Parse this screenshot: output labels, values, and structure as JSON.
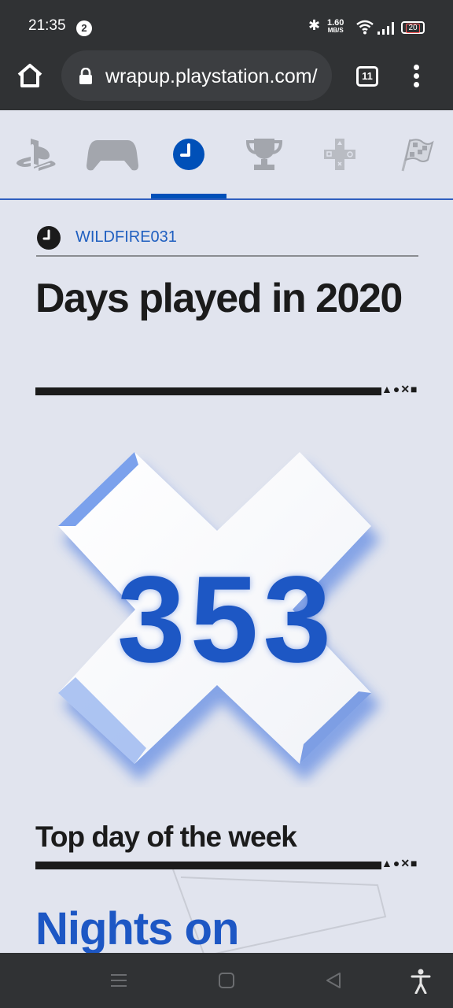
{
  "status_bar": {
    "time": "21:35",
    "notification_count": "2",
    "net_speed_value": "1.60",
    "net_speed_unit": "MB/S",
    "battery": "20"
  },
  "browser": {
    "url": "wrapup.playstation.com/",
    "tab_count": "11"
  },
  "nav": {
    "icons": [
      "playstation-logo-icon",
      "controller-icon",
      "clock-icon",
      "trophy-icon",
      "dpad-icon",
      "checkered-flag-icon"
    ],
    "active_index": 2,
    "accent_color": "#0050b8"
  },
  "content": {
    "username": "WILDFIRE031",
    "heading": "Days played in 2020",
    "days_played": "353",
    "subheading": "Top day of the week",
    "top_day_partial": "Nights on"
  },
  "colors": {
    "background": "#e1e4ee",
    "accent_blue": "#1d57c4",
    "dark_bar": "#303234"
  }
}
